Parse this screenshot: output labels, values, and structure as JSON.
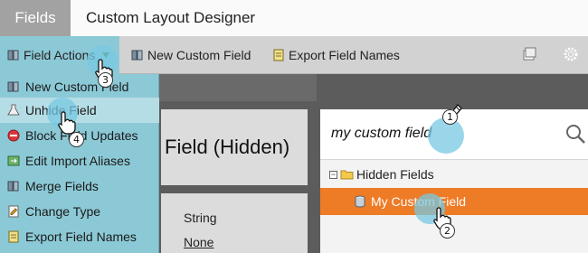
{
  "tabs": {
    "fields": "Fields",
    "designer": "Custom Layout Designer"
  },
  "toolbar": {
    "field_actions": "Field Actions",
    "new_custom_field": "New Custom Field",
    "export_field_names": "Export Field Names"
  },
  "menu": {
    "items": [
      {
        "label": "New Custom Field",
        "icon": "new-field-icon"
      },
      {
        "label": "Unhide Field",
        "icon": "flask-icon"
      },
      {
        "label": "Block Field Updates",
        "icon": "block-icon"
      },
      {
        "label": "Edit Import Aliases",
        "icon": "import-alias-icon"
      },
      {
        "label": "Merge Fields",
        "icon": "merge-icon"
      },
      {
        "label": "Change Type",
        "icon": "change-type-icon"
      },
      {
        "label": "Export Field Names",
        "icon": "export-icon"
      }
    ]
  },
  "main": {
    "title": "Field (Hidden)",
    "type_value": "String",
    "none_link": "None"
  },
  "search": {
    "value": "my custom field"
  },
  "tree": {
    "root_label": "Hidden Fields",
    "selected_label": "My Custom Field"
  },
  "steps": [
    "1",
    "2",
    "3",
    "4"
  ],
  "colors": {
    "accent": "#8cc9d6",
    "selected": "#ee7b26",
    "tab_active": "#a2a2a2"
  }
}
